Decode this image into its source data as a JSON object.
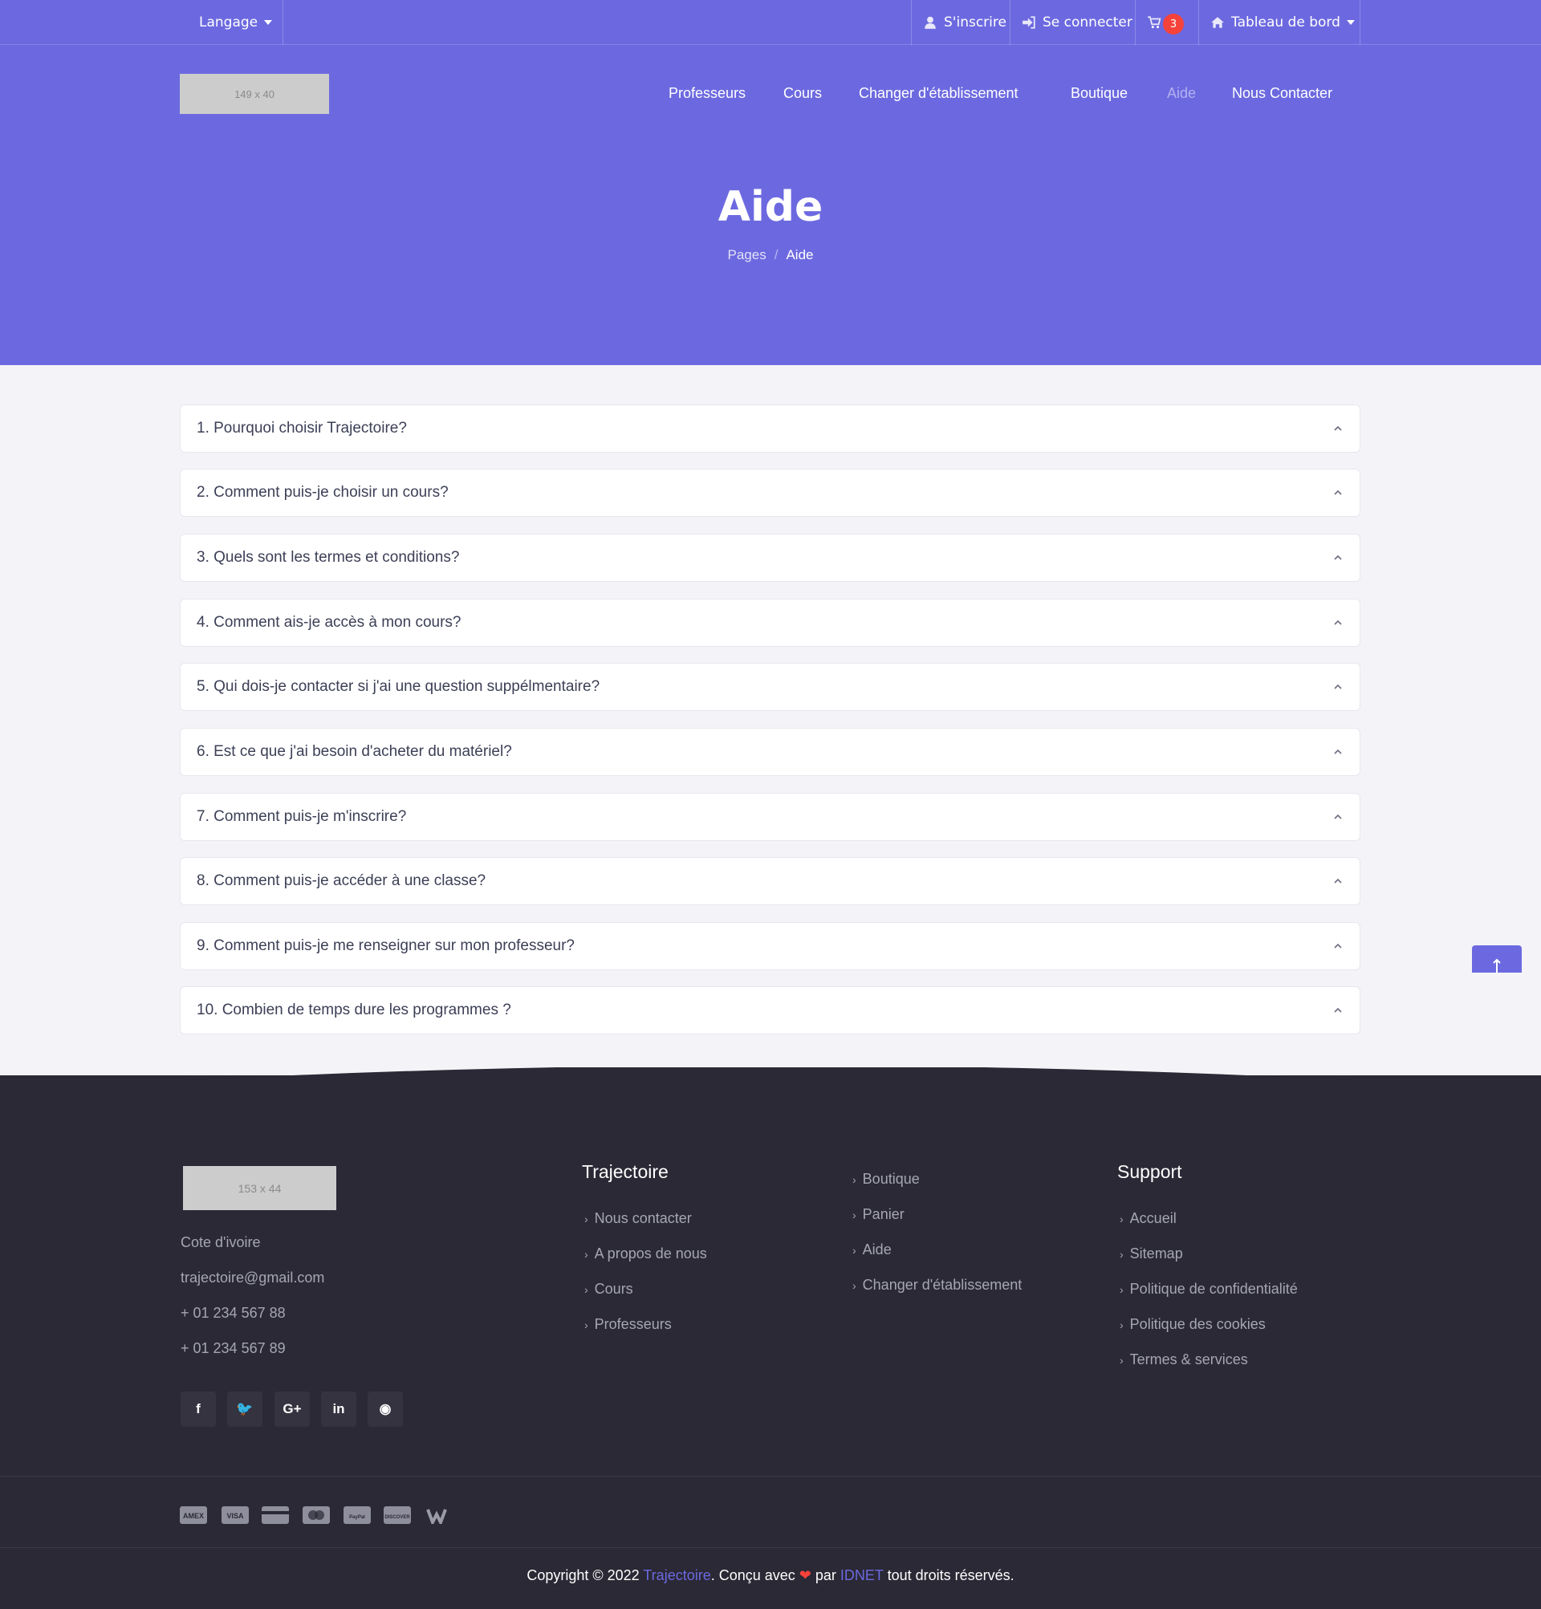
{
  "colors": {
    "primary": "#6c69e0",
    "background": "#f4f4f8",
    "footer": "#2a2935",
    "badge": "#f5423b",
    "nav_active": "#b3b1f0"
  },
  "topbar": {
    "language_label": "Langage",
    "register_label": "S'inscrire",
    "login_label": "Se connecter",
    "cart_count": "3",
    "dashboard_label": "Tableau de bord"
  },
  "header": {
    "logo_placeholder": "149 x 40",
    "nav": [
      "Professeurs",
      "Cours",
      "Changer d'établissement",
      "Boutique",
      "Aide",
      "Nous Contacter"
    ],
    "active_nav": "Aide"
  },
  "hero": {
    "title": "Aide",
    "breadcrumb": [
      "Pages",
      "Aide"
    ]
  },
  "faq": [
    "1. Pourquoi choisir Trajectoire?",
    "2. Comment puis-je choisir un cours?",
    "3. Quels sont les termes et conditions?",
    "4. Comment ais-je accès à mon cours?",
    "5. Qui dois-je contacter si j'ai une question suppélmentaire?",
    "6. Est ce que j'ai besoin d'acheter du matériel?",
    "7. Comment puis-je m'inscrire?",
    "8. Comment puis-je accéder à une classe?",
    "9. Comment puis-je me renseigner sur mon professeur?",
    "10. Combien de temps dure les programmes ?"
  ],
  "footer": {
    "logo_placeholder": "153 x 44",
    "contact": [
      "Cote d'ivoire",
      "trajectoire@gmail.com",
      "+ 01 234 567 88",
      "+ 01 234 567 89"
    ],
    "col1_title": "Trajectoire",
    "col1_links": [
      "Nous contacter",
      "A propos de nous",
      "Cours",
      "Professeurs"
    ],
    "col2_links": [
      "Boutique",
      "Panier",
      "Aide",
      "Changer d'établissement"
    ],
    "col3_title": "Support",
    "col3_links": [
      "Accueil",
      "Sitemap",
      "Politique de confidentialité",
      "Politique des cookies",
      "Termes & services"
    ],
    "social": [
      "facebook-icon",
      "twitter-icon",
      "google-plus-icon",
      "linkedin-icon",
      "github-icon"
    ],
    "social_glyphs": [
      "f",
      "🐦",
      "G+",
      "in",
      "◉"
    ],
    "payments": [
      "amex-icon",
      "visa-icon",
      "card-icon",
      "mastercard-icon",
      "paypal-icon",
      "discover-icon",
      "w-icon"
    ],
    "payment_labels": [
      "AMEX",
      "VISA",
      "",
      "",
      "PayPal",
      "DISCOVER",
      "W"
    ],
    "copyright": {
      "prefix": "Copyright © 2022 ",
      "brand": "Trajectoire",
      "middle": ". Conçu avec ",
      "heart": "❤",
      "by": " par ",
      "company": "IDNET",
      "suffix": " tout droits réservés."
    }
  }
}
